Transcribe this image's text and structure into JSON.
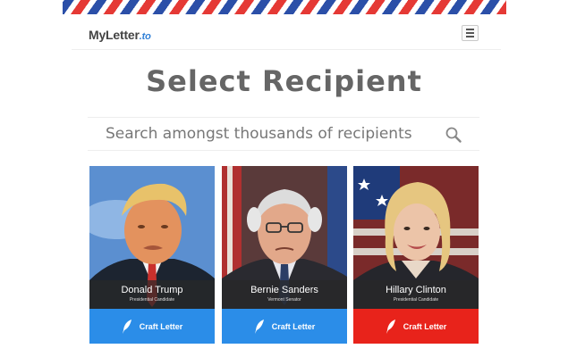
{
  "brand": {
    "name": "MyLetter",
    "tld": ".to"
  },
  "page": {
    "title": "Select Recipient"
  },
  "search": {
    "placeholder": "Search amongst thousands of recipients"
  },
  "recipients": [
    {
      "name": "Donald Trump",
      "role": "Presidential Candidate",
      "button": "Craft Letter",
      "button_color": "#2b8de8"
    },
    {
      "name": "Bernie Sanders",
      "role": "Vermont Senator",
      "button": "Craft Letter",
      "button_color": "#2b8de8"
    },
    {
      "name": "Hillary Clinton",
      "role": "Presidential Candidate",
      "button": "Craft Letter",
      "button_color": "#e8231b"
    }
  ],
  "colors": {
    "airmail_red": "#e53935",
    "airmail_blue": "#2b4fa8",
    "accent_blue": "#2b8de8",
    "accent_red": "#e8231b"
  }
}
